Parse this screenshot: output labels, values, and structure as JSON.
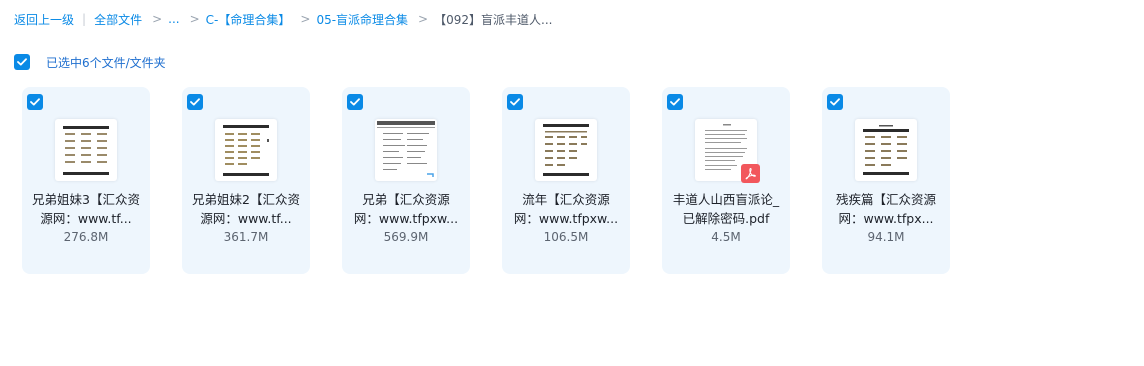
{
  "breadcrumb": {
    "back": "返回上一级",
    "all_files": "全部文件",
    "ellipsis": "...",
    "folder1": "C-【命理合集】",
    "folder2": "05-盲派命理合集",
    "current": "【092】盲派丰道人..."
  },
  "selection": {
    "text": "已选中6个文件/文件夹",
    "checked": true
  },
  "accent_color": "#0a8ae6",
  "files": [
    {
      "name_line1": "兄弟姐妹3【汇众资",
      "name_line2": "源网：www.tf...",
      "size": "276.8M",
      "icon": "document-thumbnail",
      "selected": true
    },
    {
      "name_line1": "兄弟姐妹2【汇众资",
      "name_line2": "源网：www.tf...",
      "size": "361.7M",
      "icon": "document-thumbnail",
      "selected": true
    },
    {
      "name_line1": "兄弟【汇众资源",
      "name_line2": "网：www.tfpxw...",
      "size": "569.9M",
      "icon": "document-thumbnail",
      "selected": true
    },
    {
      "name_line1": "流年【汇众资源",
      "name_line2": "网：www.tfpxw...",
      "size": "106.5M",
      "icon": "document-thumbnail",
      "selected": true
    },
    {
      "name_line1": "丰道人山西盲派论_",
      "name_line2": "已解除密码.pdf",
      "size": "4.5M",
      "icon": "pdf-icon",
      "selected": true
    },
    {
      "name_line1": "残疾篇【汇众资源",
      "name_line2": "网：www.tfpx...",
      "size": "94.1M",
      "icon": "document-thumbnail",
      "selected": true
    }
  ]
}
